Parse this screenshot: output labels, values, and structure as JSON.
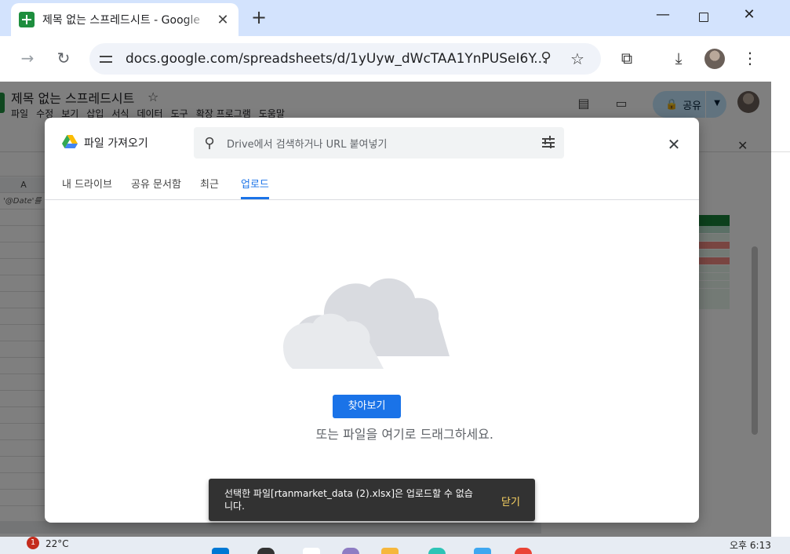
{
  "browser": {
    "tab_title": "제목 없는 스프레드시트 - Google",
    "url_host": "docs.google.com",
    "url_path": "/spreadsheets/d/1yUyw_dWcTAA1YnPUSeI6Y...",
    "new_tab_symbol": "+",
    "icons": {
      "back": "arrow-left-icon",
      "reload": "reload-icon",
      "zoom": "magnifier-icon",
      "bookmark": "star-icon",
      "extensions": "puzzle-icon",
      "downloads": "download-icon",
      "menu": "kebab-icon"
    }
  },
  "sheet": {
    "doc_title": "제목 없는 스프레드시트",
    "menu": [
      "파일",
      "수정",
      "보기",
      "삽입",
      "서식",
      "데이터",
      "도구",
      "확장 프로그램",
      "도움말"
    ],
    "share_label": "공유",
    "column_a": "A",
    "cell_a1_hint": "'@Date'를"
  },
  "dialog": {
    "title": "파일 가져오기",
    "search_placeholder": "Drive에서 검색하거나 URL 붙여넣기",
    "tabs": [
      {
        "label": "내 드라이브",
        "active": false
      },
      {
        "label": "공유 문서함",
        "active": false
      },
      {
        "label": "최근",
        "active": false
      },
      {
        "label": "업로드",
        "active": true
      }
    ],
    "browse_label": "찾아보기",
    "drag_text": "또는 파일을 여기로 드래그하세요.",
    "accent_color": "#1a73e8"
  },
  "snackbar": {
    "message": "선택한 파일[rtanmarket_data (2).xlsx]은 업로드할 수 없습니다.",
    "close_label": "닫기"
  },
  "taskbar": {
    "badge": "1",
    "temperature": "22°C",
    "time": "오후 6:13"
  }
}
